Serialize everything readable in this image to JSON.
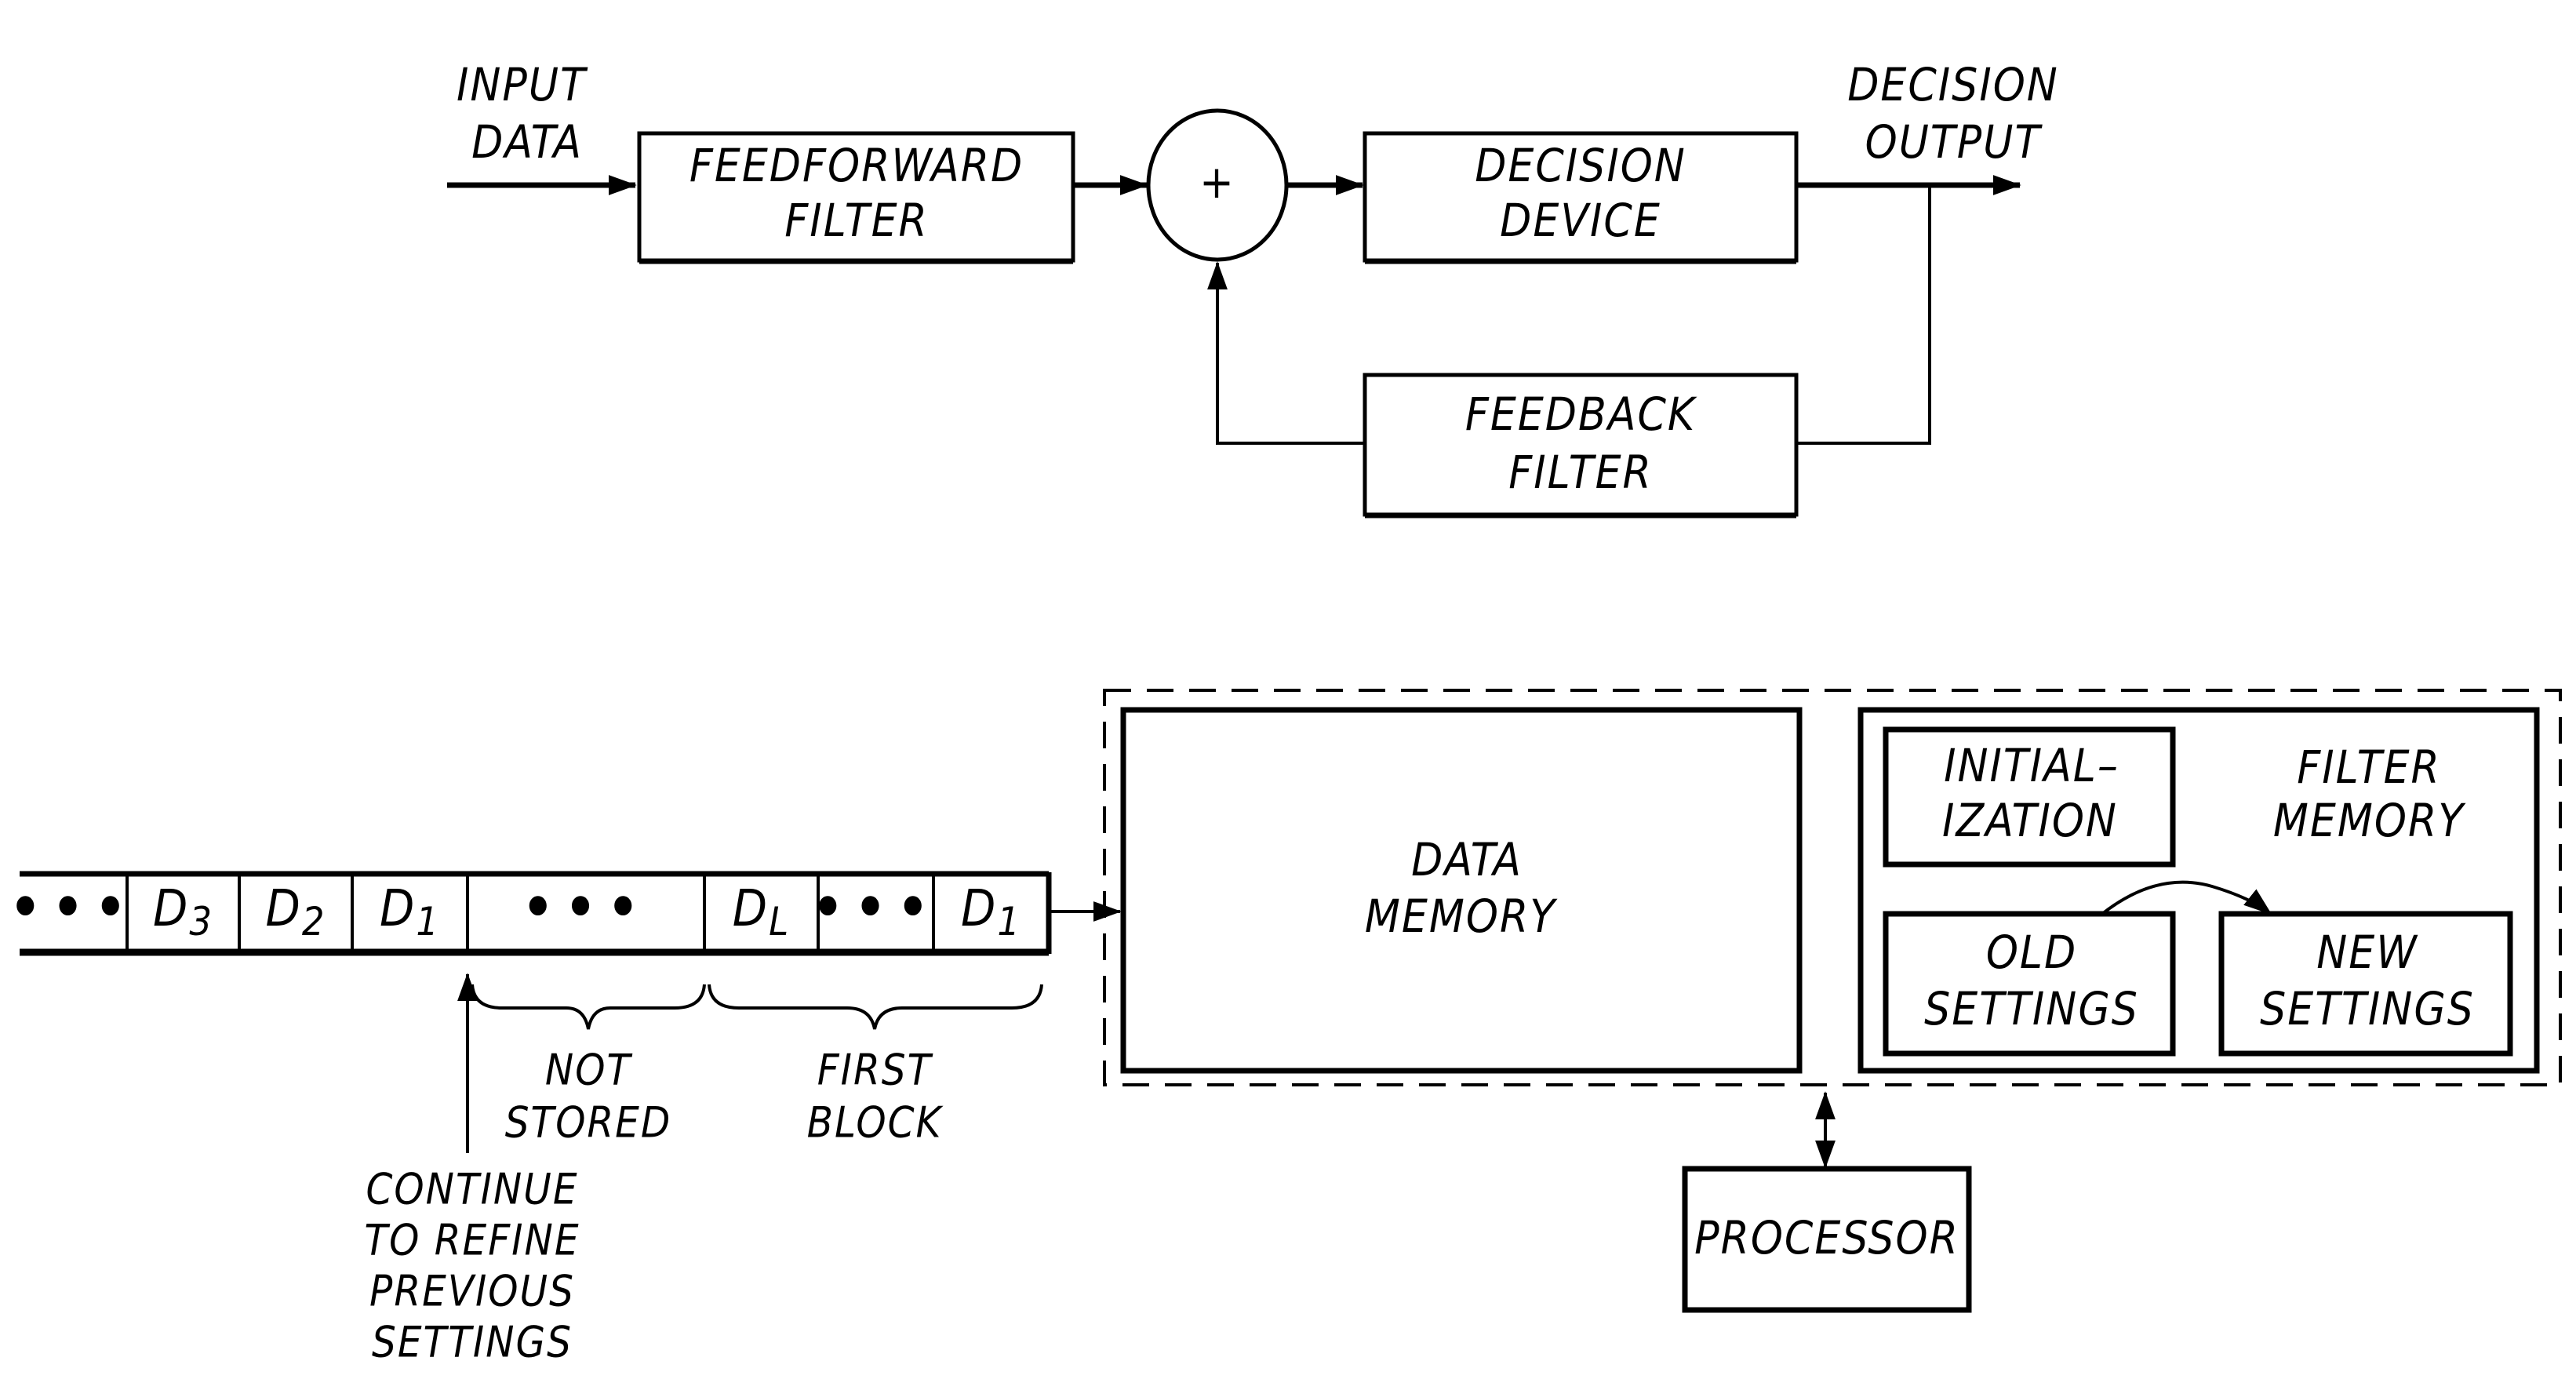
{
  "top_diagram": {
    "input_label": [
      "INPUT",
      "DATA"
    ],
    "feedforward_filter": [
      "FEEDFORWARD",
      "FILTER"
    ],
    "summer_symbol": "+",
    "decision_device": [
      "DECISION",
      "DEVICE"
    ],
    "output_label": [
      "DECISION",
      "OUTPUT"
    ],
    "feedback_filter": [
      "FEEDBACK",
      "FILTER"
    ]
  },
  "bottom_diagram": {
    "tape_cells": [
      {
        "label": "•••",
        "sub": ""
      },
      {
        "label": "D",
        "sub": "3"
      },
      {
        "label": "D",
        "sub": "2"
      },
      {
        "label": "D",
        "sub": "1"
      },
      {
        "label": "•••",
        "sub": ""
      },
      {
        "label": "D",
        "sub": "L"
      },
      {
        "label": "•••",
        "sub": ""
      },
      {
        "label": "D",
        "sub": "1"
      }
    ],
    "not_stored_label": [
      "NOT",
      "STORED"
    ],
    "first_block_label": [
      "FIRST",
      "BLOCK"
    ],
    "continue_label": [
      "CONTINUE",
      "TO REFINE",
      "PREVIOUS",
      "SETTINGS"
    ],
    "data_memory": [
      "DATA",
      "MEMORY"
    ],
    "filter_memory_title": [
      "FILTER",
      "MEMORY"
    ],
    "initialization": [
      "INITIAL–",
      "IZATION"
    ],
    "old_settings": [
      "OLD",
      "SETTINGS"
    ],
    "new_settings": [
      "NEW",
      "SETTINGS"
    ],
    "processor": "PROCESSOR"
  }
}
